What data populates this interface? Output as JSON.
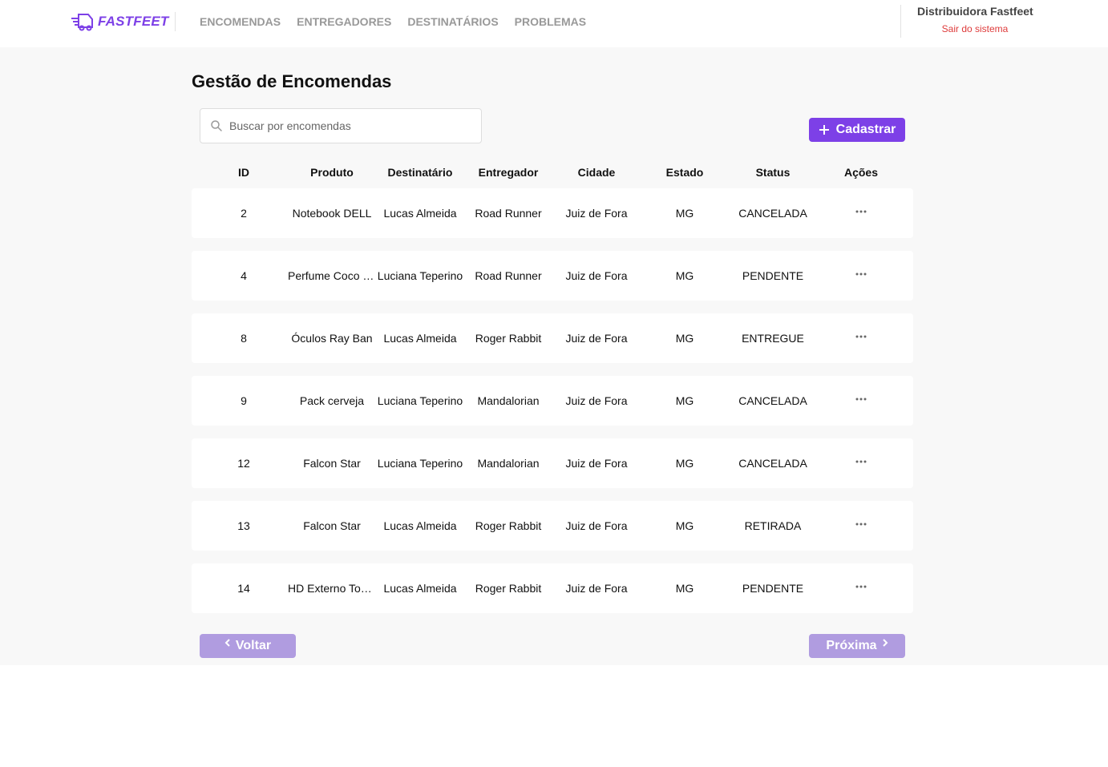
{
  "brand": {
    "name": "FASTFEET",
    "accent": "#7d40e7"
  },
  "nav": {
    "items": [
      {
        "label": "ENCOMENDAS"
      },
      {
        "label": "ENTREGADORES"
      },
      {
        "label": "DESTINATÁRIOS"
      },
      {
        "label": "PROBLEMAS"
      }
    ]
  },
  "user": {
    "name": "Distribuidora Fastfeet",
    "logout_label": "Sair do sistema"
  },
  "page": {
    "title": "Gestão de Encomendas"
  },
  "search": {
    "placeholder": "Buscar por encomendas",
    "value": "",
    "icon": "search-icon"
  },
  "add_button": {
    "label": "Cadastrar",
    "icon": "plus-icon"
  },
  "table": {
    "headers": {
      "id": "ID",
      "product": "Produto",
      "recipient": "Destinatário",
      "deliveryman": "Entregador",
      "city": "Cidade",
      "state": "Estado",
      "status": "Status",
      "actions": "Ações"
    },
    "rows": [
      {
        "id": "2",
        "product": "Notebook DELL",
        "recipient": "Lucas Almeida",
        "deliveryman": "Road Runner",
        "city": "Juiz de Fora",
        "state": "MG",
        "status": "CANCELADA"
      },
      {
        "id": "4",
        "product": "Perfume Coco Chanel",
        "recipient": "Luciana Teperino",
        "deliveryman": "Road Runner",
        "city": "Juiz de Fora",
        "state": "MG",
        "status": "PENDENTE"
      },
      {
        "id": "8",
        "product": "Óculos Ray Ban",
        "recipient": "Lucas Almeida",
        "deliveryman": "Roger Rabbit",
        "city": "Juiz de Fora",
        "state": "MG",
        "status": "ENTREGUE"
      },
      {
        "id": "9",
        "product": "Pack cerveja",
        "recipient": "Luciana Teperino",
        "deliveryman": "Mandalorian",
        "city": "Juiz de Fora",
        "state": "MG",
        "status": "CANCELADA"
      },
      {
        "id": "12",
        "product": "Falcon Star",
        "recipient": "Luciana Teperino",
        "deliveryman": "Mandalorian",
        "city": "Juiz de Fora",
        "state": "MG",
        "status": "CANCELADA"
      },
      {
        "id": "13",
        "product": "Falcon Star",
        "recipient": "Lucas Almeida",
        "deliveryman": "Roger Rabbit",
        "city": "Juiz de Fora",
        "state": "MG",
        "status": "RETIRADA"
      },
      {
        "id": "14",
        "product": "HD Externo Toshiba",
        "recipient": "Lucas Almeida",
        "deliveryman": "Roger Rabbit",
        "city": "Juiz de Fora",
        "state": "MG",
        "status": "PENDENTE"
      }
    ]
  },
  "pagination": {
    "prev_label": "Voltar",
    "next_label": "Próxima"
  }
}
